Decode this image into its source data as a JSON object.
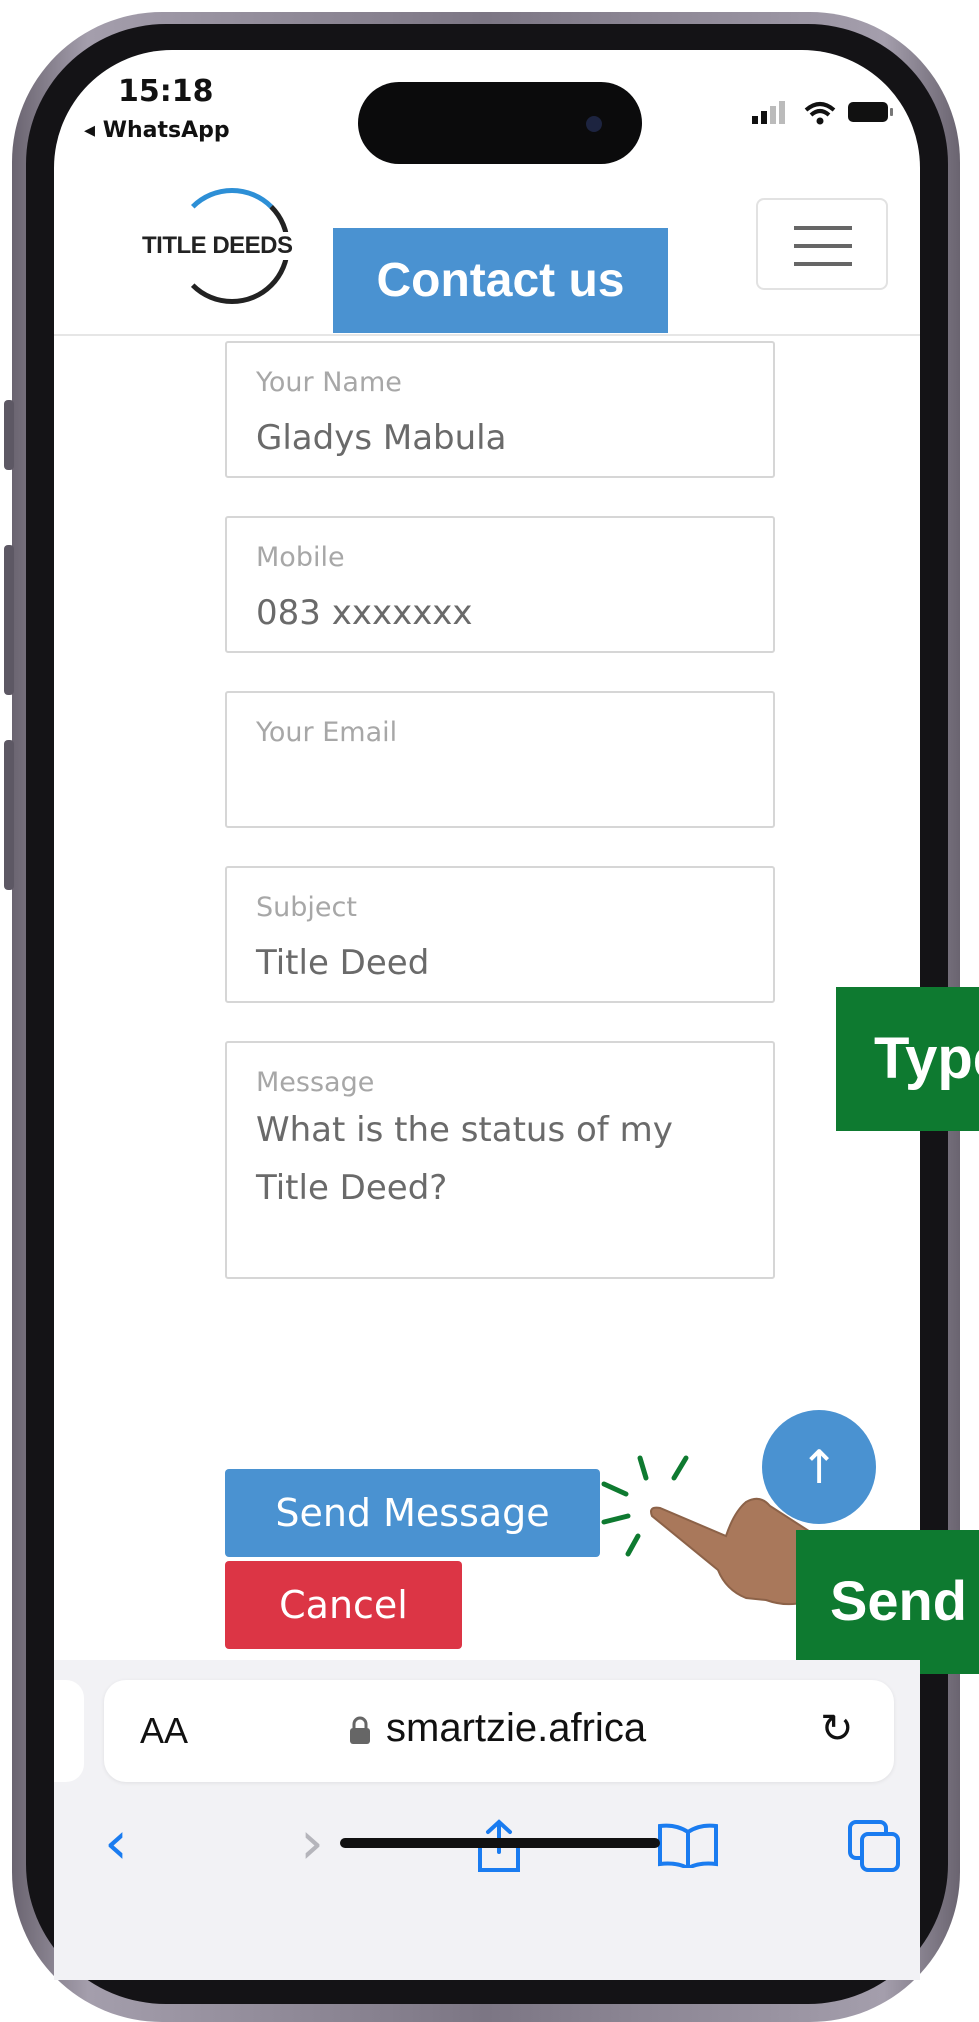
{
  "status_bar": {
    "time": "15:18",
    "back_app": "◂ WhatsApp"
  },
  "header": {
    "logo_text": "TITLE DEEDS",
    "banner": "Contact us",
    "menu_icon": "hamburger-icon"
  },
  "form": {
    "name": {
      "label": "Your Name",
      "value": "Gladys Mabula"
    },
    "mobile": {
      "label": "Mobile",
      "value": "083 xxxxxxx"
    },
    "email": {
      "label": "Your Email",
      "value": ""
    },
    "subject": {
      "label": "Subject",
      "value": "Title Deed"
    },
    "message": {
      "label": "Message",
      "value": "What is the status of my Title Deed?"
    },
    "send_label": "Send Message",
    "cancel_label": "Cancel",
    "scroll_top_icon": "↑"
  },
  "annotations": {
    "type_banner": "Type your message",
    "send_banner": "Send"
  },
  "browser": {
    "aa": "AA",
    "url": "smartzie.africa",
    "reload_icon": "↻",
    "back_icon": "‹",
    "forward_icon": "›"
  },
  "colors": {
    "accent": "#4a92d1",
    "danger": "#dc3545",
    "annotation_green": "#0e7a30",
    "safari_blue": "#1a7cf0"
  }
}
